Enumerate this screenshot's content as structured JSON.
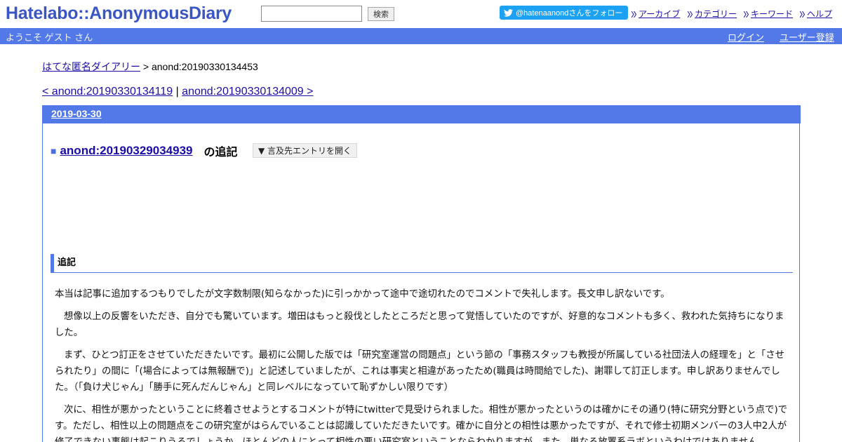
{
  "header": {
    "logo": "Hatelabo::AnonymousDiary",
    "search": {
      "value": "",
      "button_label": "検索"
    },
    "follow_label": "@hatenaanondさんをフォロー",
    "links": [
      "アーカイブ",
      "カテゴリー",
      "キーワード",
      "ヘルプ"
    ]
  },
  "bar": {
    "welcome": "ようこそ ゲスト さん",
    "login": "ログイン",
    "register": "ユーザー登録"
  },
  "breadcrumb": {
    "home": "はてな匿名ダイアリー",
    "separator": " > ",
    "current": "anond:20190330134453"
  },
  "prevnext": {
    "prev": "< anond:20190330134119",
    "separator": " | ",
    "next": "anond:20190330134009 >"
  },
  "day": {
    "date": "2019-03-30",
    "section_marker": "■",
    "section_link": "anond:20190329034939",
    "section_suffix": "の追記",
    "open_refs_label": "▼ 言及先エントリを開く",
    "subheading": "追記",
    "paragraphs": [
      "本当は記事に追加するつもりでしたが文字数制限(知らなかった)に引っかかって途中で途切れたのでコメントで失礼します。長文申し訳ないです。",
      "想像以上の反響をいただき、自分でも驚いています。増田はもっと殺伐としたところだと思って覚悟していたのですが、好意的なコメントも多く、救われた気持ちになりました。",
      "まず、ひとつ訂正をさせていただきたいです。最初に公開した版では「研究室運営の問題点」という節の「事務スタッフも教授が所属している社団法人の経理を」と「させられたり」の間に「(場合によっては無報酬で)」と記述していましたが、これは事実と相違があったため(職員は時間給でした)、謝罪して訂正します。申し訳ありませんでした。（「負け犬じゃん」「勝手に死んだんじゃん」と同レベルになっていて恥ずかしい限りです）",
      "次に、相性が悪かったということに終着させようとするコメントが特にtwitterで見受けられました。相性が悪かったというのは確かにその通り(特に研究分野という点で)です。ただし、相性以上の問題点をこの研究室がはらんでいることは認識していただきたいです。確かに自分との相性は悪かったですが、それで修士初期メンバーの3人中2人が修了できない事態は起こりうるでしょうか。ほとんどの人にとって相性の悪い研究室ということならわかりますが。また、単なる放置系ラボというわけではありません。"
    ]
  }
}
